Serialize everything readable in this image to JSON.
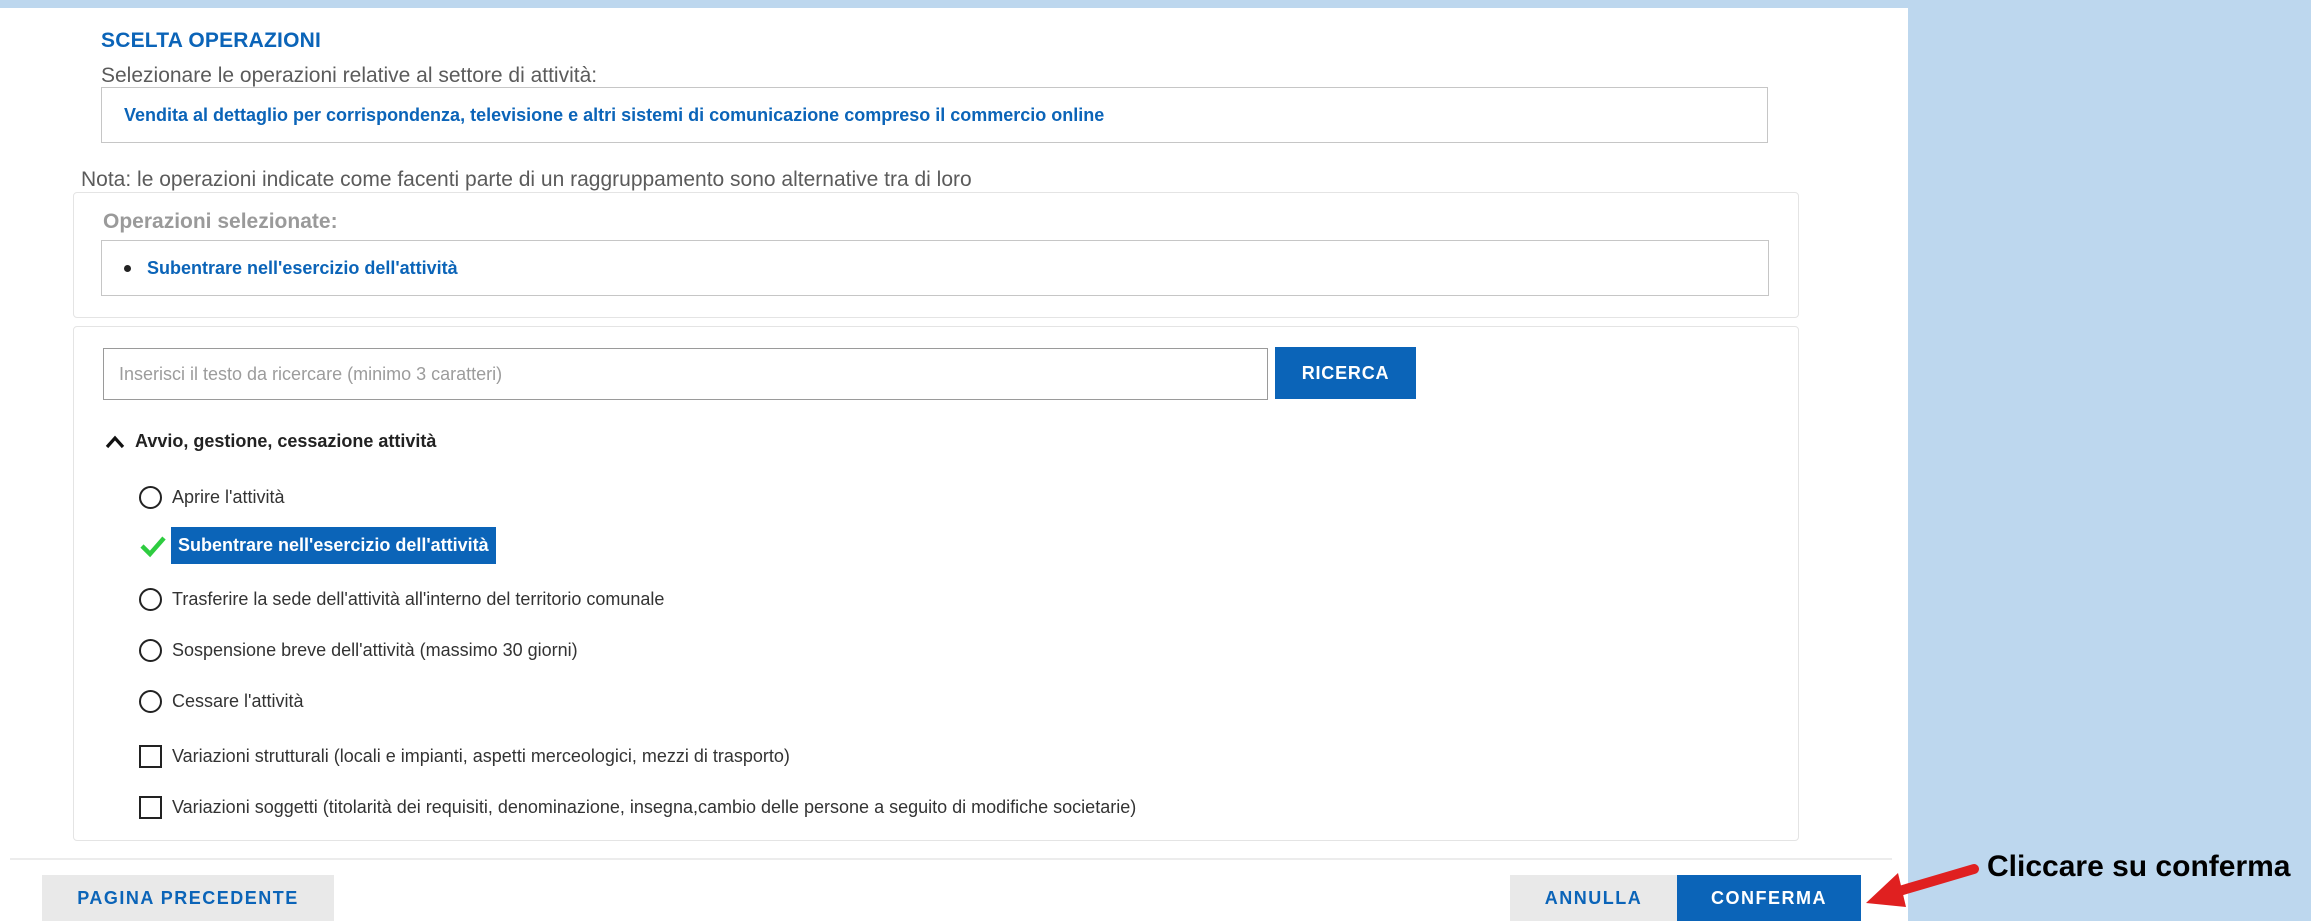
{
  "section": {
    "title": "SCELTA OPERAZIONI",
    "subtitle": "Selezionare le operazioni relative al settore di attività:",
    "sector_value": "Vendita al dettaglio per corrispondenza, televisione e altri sistemi di comunicazione compreso il commercio online"
  },
  "note": "Nota: le operazioni indicate come facenti parte di un raggruppamento sono alternative tra di loro",
  "selected": {
    "title": "Operazioni selezionate:",
    "items": [
      "Subentrare nell'esercizio dell'attività"
    ]
  },
  "search": {
    "placeholder": "Inserisci il testo da ricercare (minimo 3 caratteri)",
    "button_label": "RICERCA"
  },
  "group": {
    "title": "Avvio, gestione, cessazione attività",
    "options": [
      {
        "label": "Aprire l'attività",
        "type": "radio",
        "selected": false
      },
      {
        "label": "Subentrare nell'esercizio dell'attività",
        "type": "radio",
        "selected": true
      },
      {
        "label": "Trasferire la sede dell'attività all'interno del territorio comunale",
        "type": "radio",
        "selected": false
      },
      {
        "label": "Sospensione breve dell'attività (massimo 30 giorni)",
        "type": "radio",
        "selected": false
      },
      {
        "label": "Cessare l'attività",
        "type": "radio",
        "selected": false
      },
      {
        "label": "Variazioni strutturali (locali e impianti, aspetti merceologici, mezzi di trasporto)",
        "type": "checkbox",
        "selected": false
      },
      {
        "label": "Variazioni soggetti (titolarità dei requisiti, denominazione, insegna,cambio delle persone a seguito di modifiche societarie)",
        "type": "checkbox",
        "selected": false
      }
    ]
  },
  "footer": {
    "prev_label": "PAGINA PRECEDENTE",
    "cancel_label": "ANNULLA",
    "confirm_label": "CONFERMA"
  },
  "callout": {
    "text": "Cliccare su conferma"
  },
  "colors": {
    "primary": "#0b64b8",
    "background": "#bdd7ee",
    "check": "#2ecc40",
    "arrow": "#e02020"
  }
}
